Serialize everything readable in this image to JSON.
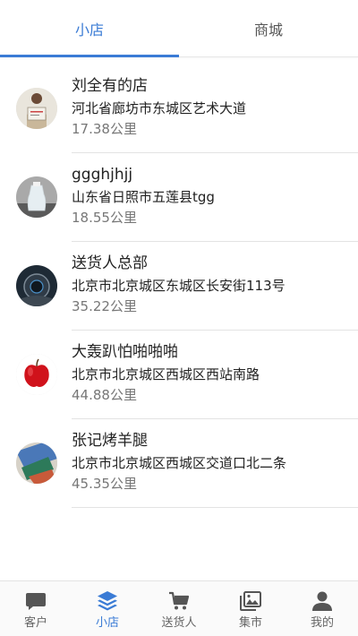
{
  "top_tabs": [
    {
      "label": "小店",
      "active": true
    },
    {
      "label": "商城",
      "active": false
    }
  ],
  "stores": [
    {
      "name": "刘全有的店",
      "address": "河北省廊坊市东城区艺术大道",
      "distance": "17.38公里"
    },
    {
      "name": "ggghjhjj",
      "address": "山东省日照市五莲县tgg",
      "distance": "18.55公里"
    },
    {
      "name": "送货人总部",
      "address": "北京市北京城区东城区长安街113号",
      "distance": "35.22公里"
    },
    {
      "name": "大轰趴怕啪啪啪",
      "address": "北京市北京城区西城区西站南路",
      "distance": "44.88公里"
    },
    {
      "name": "张记烤羊腿",
      "address": "北京市北京城区西城区交道口北二条",
      "distance": "45.35公里"
    }
  ],
  "bottom_nav": [
    {
      "label": "客户",
      "icon": "chat-icon",
      "active": false
    },
    {
      "label": "小店",
      "icon": "layers-icon",
      "active": true
    },
    {
      "label": "送货人",
      "icon": "cart-icon",
      "active": false
    },
    {
      "label": "集市",
      "icon": "image-gallery-icon",
      "active": false
    },
    {
      "label": "我的",
      "icon": "person-icon",
      "active": false
    }
  ],
  "colors": {
    "accent": "#3a7bd5",
    "inactive": "#666666",
    "divider": "#e3e3e3"
  }
}
